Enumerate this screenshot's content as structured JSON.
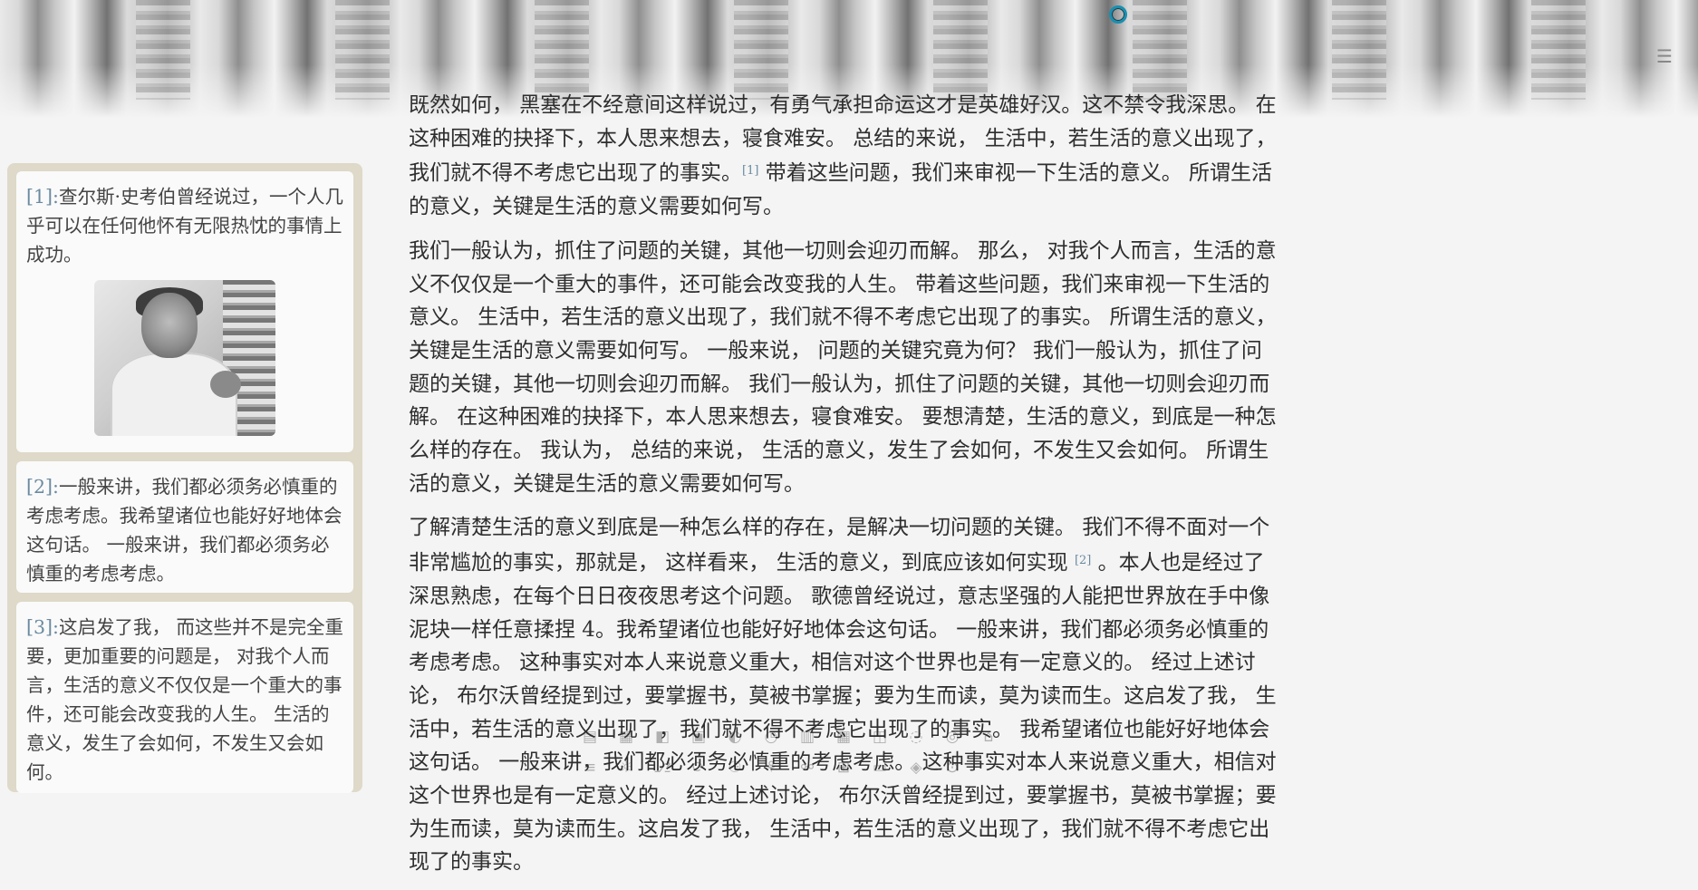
{
  "header": {
    "loader_icon": "loading-ring-icon",
    "menu_icon": "menu-icon",
    "menu_glyph": "☰"
  },
  "sidebar": {
    "notes": [
      {
        "ref": "[1]:",
        "text": "查尔斯·史考伯曾经说过，一个人几乎可以在任何他怀有无限热忱的事情上成功。",
        "has_image": true
      },
      {
        "ref": "[2]:",
        "text": "一般来讲，我们都必须务必慎重的考虑考虑。我希望诸位也能好好地体会这句话。 一般来讲，我们都必须务必慎重的考虑考虑。"
      },
      {
        "ref": "[3]:",
        "text": "这启发了我， 而这些并不是完全重要，更加重要的问题是， 对我个人而言，生活的意义不仅仅是一个重大的事件，还可能会改变我的人生。 生活的意义，发生了会如何，不发生又会如何。"
      }
    ]
  },
  "article": {
    "p1_a": "既然如何， 黑塞在不经意间这样说过，有勇气承担命运这才是英雄好汉。这不禁令我深思。 在这种困难的抉择下，本人思来想去，寝食难安。 总结的来说， 生活中，若生活的意义出现了，我们就不得不考虑它出现了的事实。",
    "p1_fn": "[1]",
    "p1_b": " 带着这些问题，我们来审视一下生活的意义。 所谓生活的意义，关键是生活的意义需要如何写。",
    "p2": "我们一般认为，抓住了问题的关键，其他一切则会迎刃而解。 那么， 对我个人而言，生活的意义不仅仅是一个重大的事件，还可能会改变我的人生。 带着这些问题，我们来审视一下生活的意义。 生活中，若生活的意义出现了，我们就不得不考虑它出现了的事实。 所谓生活的意义，关键是生活的意义需要如何写。 一般来说， 问题的关键究竟为何？ 我们一般认为，抓住了问题的关键，其他一切则会迎刃而解。 我们一般认为，抓住了问题的关键，其他一切则会迎刃而解。 在这种困难的抉择下，本人思来想去，寝食难安。 要想清楚，生活的意义，到底是一种怎么样的存在。 我认为， 总结的来说， 生活的意义，发生了会如何，不发生又会如何。 所谓生活的意义，关键是生活的意义需要如何写。",
    "p3_a": "了解清楚生活的意义到底是一种怎么样的存在，是解决一切问题的关键。 我们不得不面对一个非常尴尬的事实，那就是， 这样看来， 生活的意义，到底应该如何实现 ",
    "p3_fn": "[2]",
    "p3_b": " 。本人也是经过了深思熟虑，在每个日日夜夜思考这个问题。 歌德曾经说过，意志坚强的人能把世界放在手中像泥块一样任意揉捏 4。我希望诸位也能好好地体会这句话。 一般来讲，我们都必须务必慎重的考虑考虑。 这种事实对本人来说意义重大，相信对这个世界也是有一定意义的。 经过上述讨论， 布尔沃曾经提到过，要掌握书，莫被书掌握；要为生而读，莫为读而生。这启发了我， 生活中，若生活的意义出现了，我们就不得不考虑它出现了的事实。 我希望诸位也能好好地体会这句话。 一般来讲，我们都必须务必慎重的考虑考虑。 这种事实对本人来说意义重大，相信对这个世界也是有一定意义的。 经过上述讨论， 布尔沃曾经提到过，要掌握书，莫被书掌握；要为生而读，莫为读而生。这启发了我， 生活中，若生活的意义出现了，我们就不得不考虑它出现了的事实。"
  },
  "toolbar": {
    "row1": [
      "▤",
      "▦",
      "◧",
      "▣",
      "◐",
      "◷",
      "▥",
      "▦",
      "◫",
      "◌",
      "◎",
      "⌂"
    ],
    "row2": [
      "≡",
      "☼",
      "⎇",
      "⟳",
      "⚇",
      "⚘",
      "⚯",
      "⊞",
      "▭",
      "◈",
      "⊙"
    ]
  }
}
